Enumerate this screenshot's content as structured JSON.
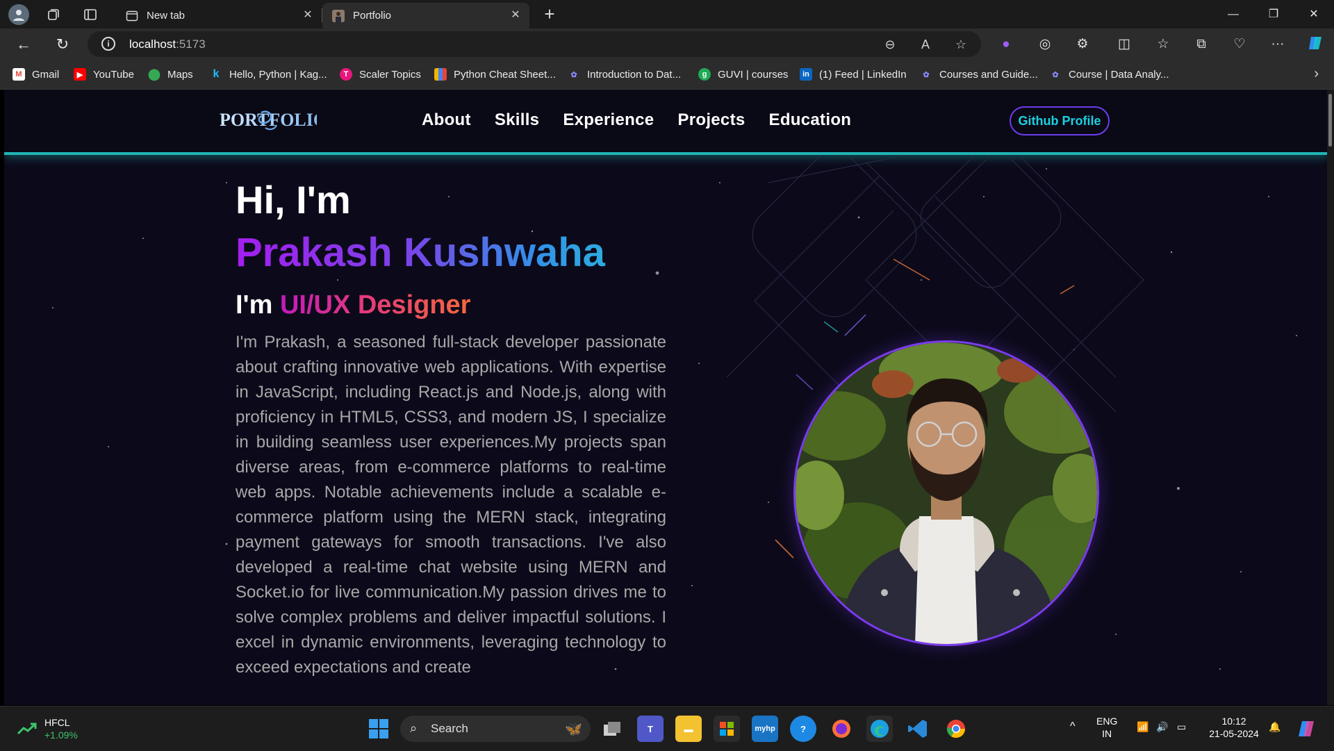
{
  "browser": {
    "tabs": [
      {
        "title": "New tab",
        "active": false
      },
      {
        "title": "Portfolio",
        "active": true
      }
    ],
    "address": {
      "host": "localhost",
      "port": ":5173"
    },
    "bookmarks": [
      {
        "label": "Gmail",
        "icon": "gmail-icon",
        "color": "#ea4335"
      },
      {
        "label": "YouTube",
        "icon": "youtube-icon",
        "color": "#ff0000"
      },
      {
        "label": "Maps",
        "icon": "maps-icon",
        "color": "#34a853"
      },
      {
        "label": "Hello, Python | Kag...",
        "icon": "kaggle-icon",
        "color": "#20beff"
      },
      {
        "label": "Scaler Topics",
        "icon": "scaler-icon",
        "color": "#e9157d"
      },
      {
        "label": "Python Cheat Sheet...",
        "icon": "bars-icon",
        "color": "#f4b400"
      },
      {
        "label": "Introduction to Dat...",
        "icon": "course-icon",
        "color": "#8a8aff"
      },
      {
        "label": "GUVI | courses",
        "icon": "guvi-icon",
        "color": "#1faa55"
      },
      {
        "label": "(1) Feed | LinkedIn",
        "icon": "linkedin-icon",
        "color": "#0a66c2"
      },
      {
        "label": "Courses and Guide...",
        "icon": "course-icon",
        "color": "#8a8aff"
      },
      {
        "label": "Course | Data Analy...",
        "icon": "course-icon",
        "color": "#8a8aff"
      }
    ]
  },
  "site": {
    "logo_text": "PORTFOLIO",
    "menu": [
      "About",
      "Skills",
      "Experience",
      "Projects",
      "Education"
    ],
    "github_button": "Github Profile",
    "hero": {
      "greeting": "Hi, I'm",
      "name": "Prakash Kushwaha",
      "role_prefix": "I'm",
      "role": "UI/UX Designer",
      "bio": "I'm Prakash, a seasoned full-stack developer passionate about crafting innovative web applications. With expertise in JavaScript, including React.js and Node.js, along with proficiency in HTML5, CSS3, and modern JS, I specialize in building seamless user experiences.My projects span diverse areas, from e-commerce platforms to real-time web apps. Notable achievements include a scalable e-commerce platform using the MERN stack, integrating payment gateways for smooth transactions. I've also developed a real-time chat website using MERN and Socket.io for live communication.My passion drives me to solve complex problems and deliver impactful solutions. I excel in dynamic environments, leveraging technology to exceed expectations and create"
    },
    "colors": {
      "accent_teal": "#1fb5b5",
      "accent_purple": "#7b3cf0",
      "background": "#0c0a1a"
    }
  },
  "taskbar": {
    "stock": {
      "symbol": "HFCL",
      "change": "+1.09%"
    },
    "search_label": "Search",
    "language": {
      "line1": "ENG",
      "line2": "IN"
    },
    "time": "10:12",
    "date": "21-05-2024"
  }
}
